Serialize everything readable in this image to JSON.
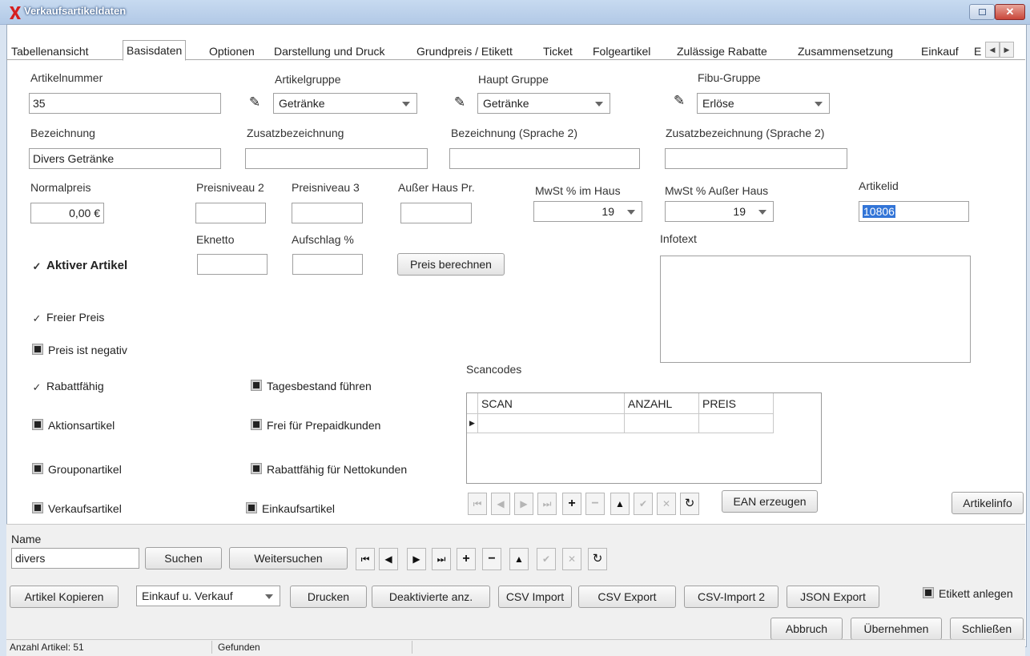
{
  "window": {
    "title": "Verkaufsartikeldaten"
  },
  "tabs": [
    {
      "label": "Tabellenansicht"
    },
    {
      "label": "Basisdaten"
    },
    {
      "label": "Optionen"
    },
    {
      "label": "Darstellung und Druck"
    },
    {
      "label": "Grundpreis / Etikett"
    },
    {
      "label": "Ticket"
    },
    {
      "label": "Folgeartikel"
    },
    {
      "label": "Zulässige Rabatte"
    },
    {
      "label": "Zusammensetzung"
    },
    {
      "label": "Einkauf"
    },
    {
      "label": "E"
    }
  ],
  "form": {
    "artikelnummer": {
      "label": "Artikelnummer",
      "value": "35"
    },
    "artikelgruppe": {
      "label": "Artikelgruppe",
      "value": "Getränke"
    },
    "hauptgruppe": {
      "label": "Haupt Gruppe",
      "value": "Getränke"
    },
    "fibugruppe": {
      "label": "Fibu-Gruppe",
      "value": "Erlöse"
    },
    "bezeichnung": {
      "label": "Bezeichnung",
      "value": "Divers Getränke"
    },
    "zusatzbezeichnung": {
      "label": "Zusatzbezeichnung",
      "value": ""
    },
    "bezeichnung2": {
      "label": "Bezeichnung (Sprache 2)",
      "value": ""
    },
    "zusatzbezeichnung2": {
      "label": "Zusatzbezeichnung (Sprache 2)",
      "value": ""
    },
    "normalpreis": {
      "label": "Normalpreis",
      "value": "0,00 €"
    },
    "preisniveau2": {
      "label": "Preisniveau 2",
      "value": ""
    },
    "preisniveau3": {
      "label": "Preisniveau 3",
      "value": ""
    },
    "ausserhaus": {
      "label": "Außer Haus Pr.",
      "value": ""
    },
    "mwst_im_haus": {
      "label": "MwSt % im Haus",
      "value": "19"
    },
    "mwst_ausser_haus": {
      "label": "MwSt % Außer Haus",
      "value": "19"
    },
    "artikelid": {
      "label": "Artikelid",
      "value": "10806"
    },
    "eknetto": {
      "label": "Eknetto",
      "value": ""
    },
    "aufschlag": {
      "label": "Aufschlag %",
      "value": ""
    },
    "preis_berechnen": "Preis berechnen",
    "infotext": {
      "label": "Infotext",
      "value": ""
    }
  },
  "checks": {
    "aktiver_artikel": {
      "label": "Aktiver Artikel",
      "checked": true
    },
    "freier_preis": {
      "label": "Freier Preis",
      "checked": true
    },
    "preis_negativ": {
      "label": "Preis ist negativ",
      "checked": false
    },
    "rabattfaehig": {
      "label": "Rabattfähig",
      "checked": true
    },
    "aktionsartikel": {
      "label": "Aktionsartikel",
      "checked": false
    },
    "grouponartikel": {
      "label": "Grouponartikel",
      "checked": false
    },
    "verkaufsartikel": {
      "label": "Verkaufsartikel",
      "checked": false
    },
    "tagesbestand": {
      "label": "Tagesbestand führen",
      "checked": false
    },
    "prepaid": {
      "label": "Frei für Prepaidkunden",
      "checked": false
    },
    "netto": {
      "label": "Rabattfähig für Nettokunden",
      "checked": false
    },
    "einkaufsartikel": {
      "label": "Einkaufsartikel",
      "checked": false
    },
    "etikett": {
      "label": "Etikett anlegen",
      "checked": false
    }
  },
  "scancodes": {
    "label": "Scancodes",
    "columns": [
      "SCAN",
      "ANZAHL",
      "PREIS"
    ],
    "ean_button": "EAN erzeugen"
  },
  "artikelinfo_button": "Artikelinfo",
  "bottom": {
    "name_label": "Name",
    "name_value": "divers",
    "suchen": "Suchen",
    "weitersuchen": "Weitersuchen",
    "kopieren": "Artikel Kopieren",
    "mode_select": "Einkauf u. Verkauf",
    "drucken": "Drucken",
    "deaktivierte": "Deaktivierte anz.",
    "csv_import": "CSV Import",
    "csv_export": "CSV Export",
    "csv_import2": "CSV-Import 2",
    "json_export": "JSON Export",
    "abbruch": "Abbruch",
    "uebernehmen": "Übernehmen",
    "schliessen": "Schließen"
  },
  "status": {
    "count": "Anzahl Artikel: 51",
    "state": "Gefunden"
  }
}
